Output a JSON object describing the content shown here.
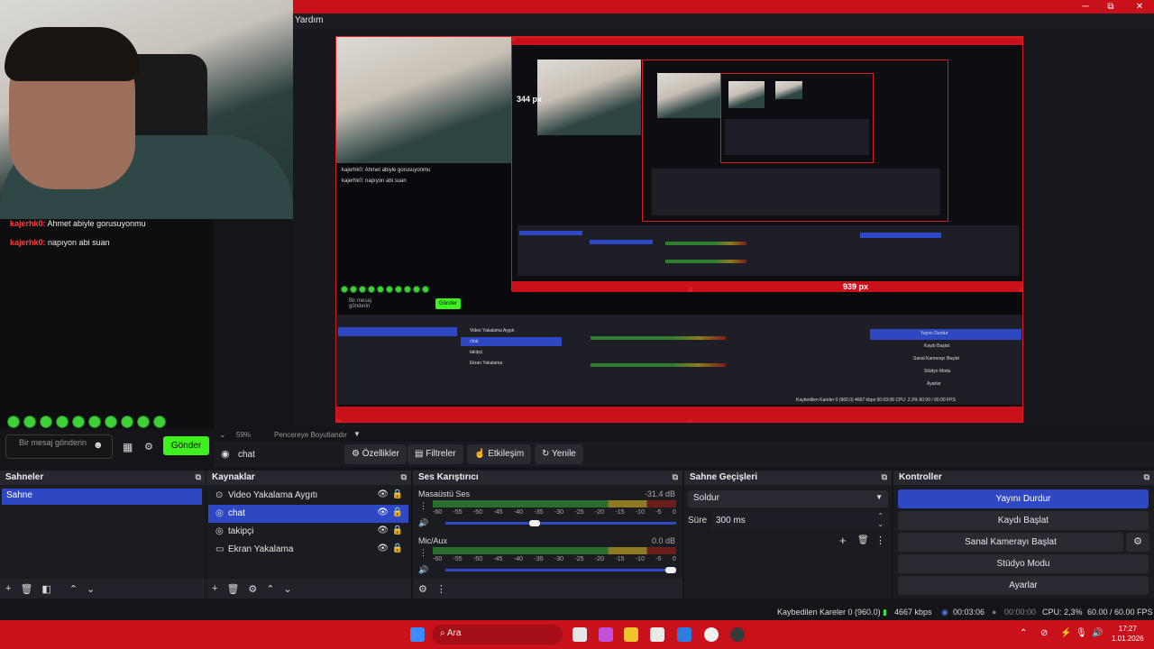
{
  "window": {
    "menu_help": "Yardım",
    "min_glyph": "─",
    "max_glyph": "⧉",
    "close_glyph": "✕"
  },
  "chat": {
    "messages": [
      {
        "user": "kajerhk0:",
        "text": " Ahmet abiyle gorusuyonmu"
      },
      {
        "user": "kajerhk0:",
        "text": " napıyon abi suan"
      }
    ],
    "input_placeholder": "Bir mesaj gönderin",
    "emoji_glyph": "☻",
    "gift_glyph": "▦",
    "gear_glyph": "⚙",
    "send_label": "Gönder"
  },
  "preview": {
    "nested_labels": [
      "344 px",
      "939 px"
    ],
    "nested_chat": [
      "kajerhk0: Ahmet abiyle gorusuyonmu",
      "kajerhk0: napıyon abi suan"
    ],
    "nested_send": "Gönder",
    "nested_placeholder": "Bir mesaj gönderin",
    "nested_sources": [
      "Video Yakalama Aygıtı",
      "chat",
      "takipçi",
      "Ekran Yakalama"
    ],
    "nested_controls": [
      "Yayını Durdur",
      "Kaydı Başlat",
      "Sanal Kamerayı Başlat",
      "Stüdyo Modu",
      "Ayarlar"
    ],
    "nested_status": "Kaybedilen Kareler 0 (960.0)   4667 kbps   00:03:06   CPU: 2.3%   60.00 / 60.00 FPS"
  },
  "zoom": {
    "chevron": "⌄",
    "value": "59%",
    "fit_label": "Pencereye Boyutlandır",
    "dropdown_glyph": "▼"
  },
  "source_toolbar": {
    "icon_glyph": "◉",
    "selected_source": "chat",
    "properties": "⚙ Özellikler",
    "filters": "▤ Filtreler",
    "interact": "☝ Etkileşim",
    "refresh": "↻ Yenile"
  },
  "scenes": {
    "title": "Sahneler",
    "items": [
      "Sahne"
    ]
  },
  "sources": {
    "title": "Kaynaklar",
    "items": [
      {
        "icon": "⊙",
        "name": "Video Yakalama Aygıtı"
      },
      {
        "icon": "◎",
        "name": "chat"
      },
      {
        "icon": "◎",
        "name": "takipçi"
      },
      {
        "icon": "▭",
        "name": "Ekran Yakalama"
      }
    ],
    "eye_glyph": "👁",
    "lock_glyph": "🔒"
  },
  "mixer": {
    "title": "Ses Karıştırıcı",
    "ticks": [
      "-60",
      "-55",
      "-50",
      "-45",
      "-40",
      "-35",
      "-30",
      "-25",
      "-20",
      "-15",
      "-10",
      "-5",
      "0"
    ],
    "channels": [
      {
        "name": "Masaüstü Ses",
        "db": "-31.4 dB",
        "volume": 0.38
      },
      {
        "name": "Mic/Aux",
        "db": "0.0 dB",
        "volume": 1.0
      }
    ]
  },
  "transitions": {
    "title": "Sahne Geçişleri",
    "type": "Soldur",
    "duration_label": "Süre",
    "duration_value": "300 ms"
  },
  "controls": {
    "title": "Kontroller",
    "buttons": [
      "Yayını Durdur",
      "Kaydı Başlat",
      "Sanal Kamerayı Başlat",
      "Stüdyo Modu",
      "Ayarlar"
    ],
    "gear_glyph": "⚙"
  },
  "footer_glyphs": {
    "add": "+",
    "remove": "🗑",
    "config": "⚙",
    "filter": "◧",
    "up": "⌃",
    "down": "⌄",
    "dots": "⋮",
    "speaker": "🔊"
  },
  "status": {
    "dropped": "Kaybedilen Kareler 0 (960.0)",
    "bitrate": "4667 kbps",
    "stream_time": "00:03:06",
    "rec_time": "00:00:00",
    "cpu": "CPU: 2,3%",
    "fps": "60.00 / 60.00 FPS"
  },
  "taskbar": {
    "search_label": "Ara",
    "time": "17:27",
    "date": "1.01.2026",
    "tray_glyphs": [
      "⌃",
      "⊘",
      "⚡",
      "🎙",
      "🔊",
      "🔋"
    ]
  }
}
